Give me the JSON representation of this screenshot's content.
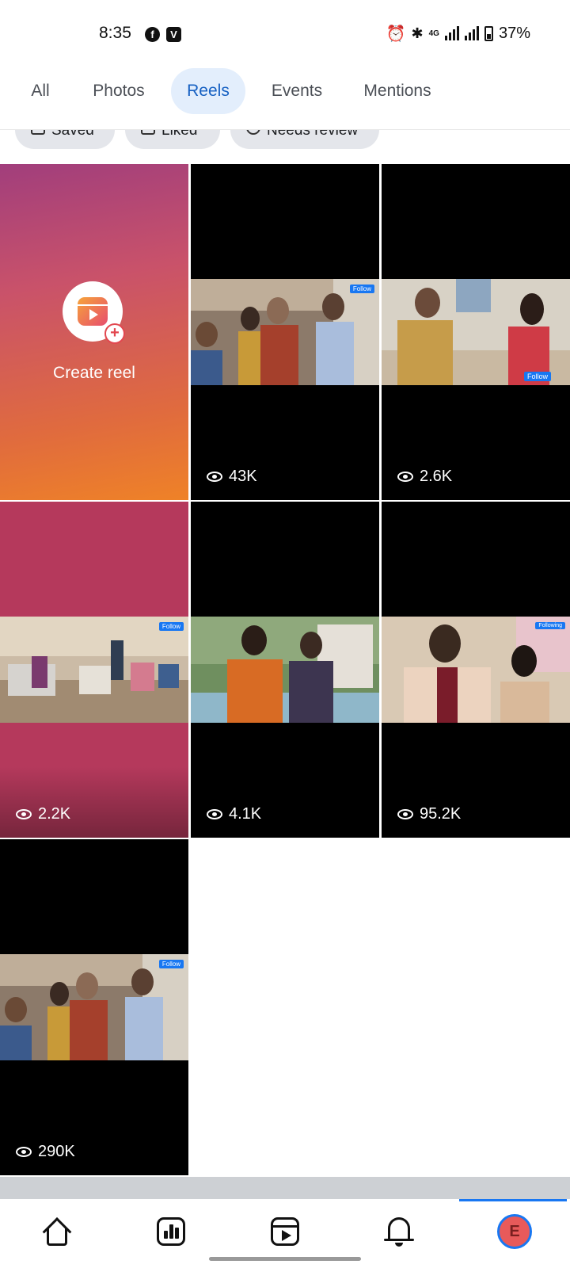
{
  "status_bar": {
    "time": "8:35",
    "app_icons": [
      "facebook-icon",
      "v-app-icon"
    ],
    "network": "4G",
    "battery": "37%"
  },
  "tabs": [
    {
      "label": "All",
      "active": false
    },
    {
      "label": "Photos",
      "active": false
    },
    {
      "label": "Reels",
      "active": true
    },
    {
      "label": "Events",
      "active": false
    },
    {
      "label": "Mentions",
      "active": false
    }
  ],
  "filters": [
    {
      "label": "Saved",
      "icon": "bookmark-icon"
    },
    {
      "label": "Liked",
      "icon": "thumbs-up-icon"
    },
    {
      "label": "Needs review",
      "icon": "review-icon"
    }
  ],
  "create_reel": {
    "label": "Create reel",
    "icon": "reels-icon"
  },
  "reels": [
    {
      "views": "43K",
      "follow": "Follow"
    },
    {
      "views": "2.6K",
      "follow": "Follow"
    },
    {
      "views": "2.2K",
      "follow": "Follow"
    },
    {
      "views": "4.1K",
      "follow": ""
    },
    {
      "views": "95.2K",
      "follow": "Following"
    },
    {
      "views": "290K",
      "follow": "Follow"
    }
  ],
  "bottom_nav": {
    "items": [
      "home-icon",
      "dashboard-icon",
      "video-icon",
      "notifications-icon",
      "profile-avatar"
    ],
    "avatar_initial": "E",
    "active_index": 4
  },
  "colors": {
    "accent": "#1877f2",
    "active_tab_bg": "#e3eefc",
    "active_tab_text": "#1660c2"
  }
}
